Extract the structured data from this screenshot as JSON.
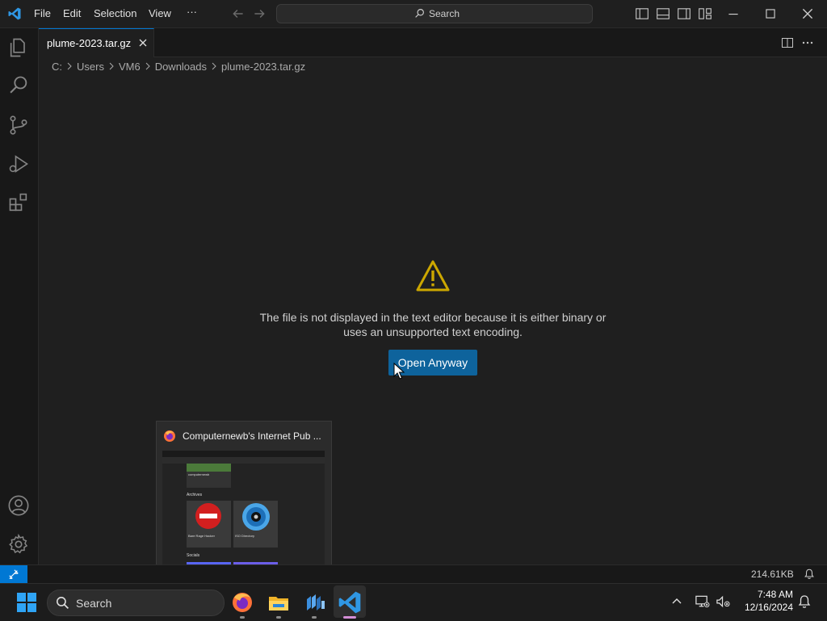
{
  "menu": {
    "file": "File",
    "edit": "Edit",
    "selection": "Selection",
    "view": "View",
    "more": "···"
  },
  "command_center": {
    "placeholder": "Search"
  },
  "tab": {
    "label": "plume-2023.tar.gz"
  },
  "breadcrumb": [
    "C:",
    "Users",
    "VM6",
    "Downloads",
    "plume-2023.tar.gz"
  ],
  "editor": {
    "message_line1": "The file is not displayed in the text editor because it is either binary or",
    "message_line2": "uses an unsupported text encoding.",
    "open_button": "Open Anyway"
  },
  "preview": {
    "title": "Computernewb's Internet Pub ...",
    "thumb_section1": "Archives",
    "thumb_item1": "Bare Rage Hacker",
    "thumb_item2": "ISO Directory",
    "thumb_item0": "computernewb",
    "thumb_section2": "Socials"
  },
  "statusbar": {
    "file_size": "214.61KB"
  },
  "taskbar": {
    "search_label": "Search",
    "time": "7:48 AM",
    "date": "12/16/2024"
  },
  "colors": {
    "accent": "#0078d4",
    "button": "#0e639c",
    "warning": "#cca700",
    "background": "#1f1f1f"
  },
  "icons": {
    "activity": [
      "explorer-icon",
      "search-icon",
      "source-control-icon",
      "run-debug-icon",
      "extensions-icon",
      "accounts-icon",
      "manage-gear-icon"
    ],
    "taskbar": [
      "windows-start-icon",
      "firefox-icon",
      "file-explorer-icon",
      "app-icon",
      "vscode-icon"
    ]
  }
}
